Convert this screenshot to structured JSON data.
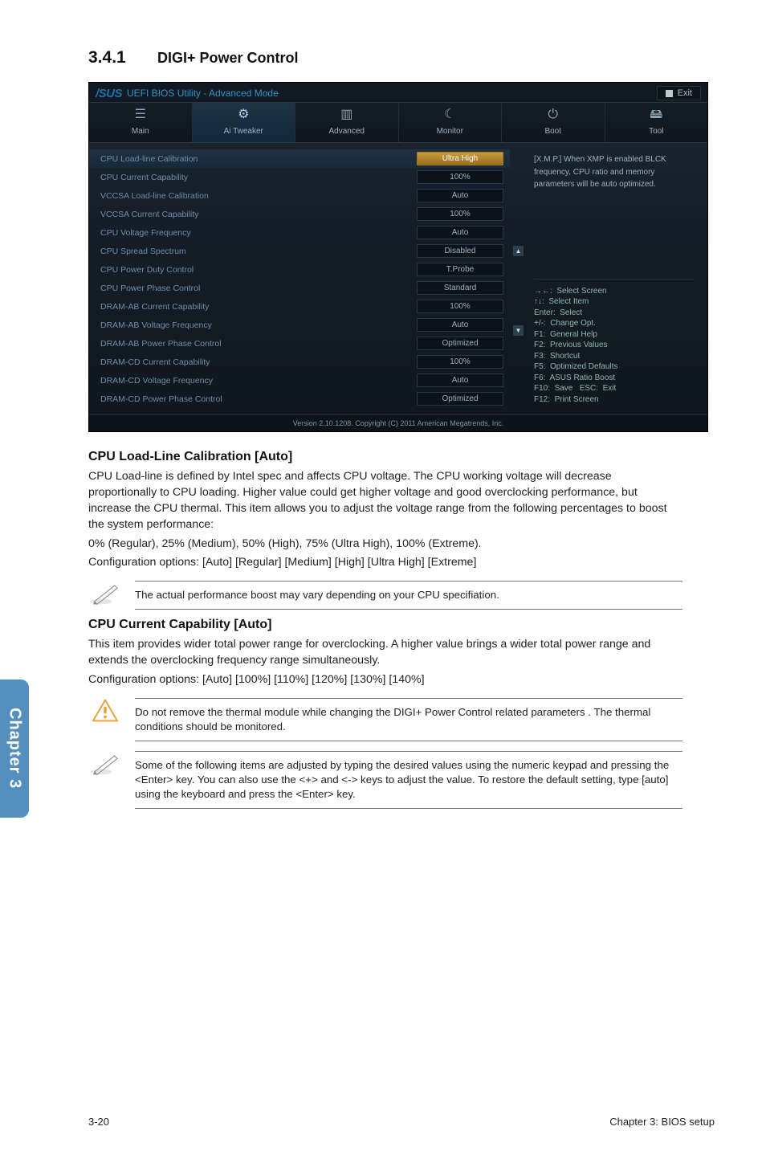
{
  "section_number": "3.4.1",
  "section_title": "DIGI+ Power Control",
  "bios": {
    "brand": "/SUS",
    "title": "UEFI BIOS Utility - Advanced Mode",
    "exit": "Exit",
    "tabs": [
      {
        "label": "Main",
        "icon": "☰"
      },
      {
        "label": "Ai Tweaker",
        "icon": "⚙"
      },
      {
        "label": "Advanced",
        "icon": "▥"
      },
      {
        "label": "Monitor",
        "icon": "☾"
      },
      {
        "label": "Boot",
        "icon": "⏻"
      },
      {
        "label": "Tool",
        "icon": "🖴"
      }
    ],
    "rows": [
      {
        "label": "CPU Load-line Calibration",
        "value": "Ultra High",
        "selected": true,
        "variant": "ultra"
      },
      {
        "label": "CPU Current Capability",
        "value": "100%"
      },
      {
        "label": "VCCSA Load-line Calibration",
        "value": "Auto"
      },
      {
        "label": "VCCSA Current Capability",
        "value": "100%"
      },
      {
        "label": "CPU Voltage Frequency",
        "value": "Auto"
      },
      {
        "label": "CPU Spread Spectrum",
        "value": "Disabled"
      },
      {
        "label": "CPU Power Duty Control",
        "value": "T.Probe"
      },
      {
        "label": "CPU Power Phase Control",
        "value": "Standard"
      },
      {
        "label": "DRAM-AB Current Capability",
        "value": "100%"
      },
      {
        "label": "DRAM-AB Voltage Frequency",
        "value": "Auto"
      },
      {
        "label": "DRAM-AB Power Phase Control",
        "value": "Optimized"
      },
      {
        "label": "DRAM-CD Current Capability",
        "value": "100%"
      },
      {
        "label": "DRAM-CD Voltage Frequency",
        "value": "Auto"
      },
      {
        "label": "DRAM-CD Power Phase Control",
        "value": "Optimized"
      }
    ],
    "info_lines": [
      "[X.M.P.] When XMP is enabled BLCK",
      "frequency, CPU ratio and memory",
      "parameters will be auto optimized."
    ],
    "help_lines": [
      "→←:  Select Screen",
      "↑↓:  Select Item",
      "Enter:  Select",
      "+/-:  Change Opt.",
      "F1:  General Help",
      "F2:  Previous Values",
      "F3:  Shortcut",
      "F5:  Optimized Defaults",
      "F6:  ASUS Ratio Boost",
      "F10:  Save   ESC:  Exit",
      "F12:  Print Screen"
    ],
    "footer": "Version  2.10.1208.   Copyright  (C)  2011  American  Megatrends,  Inc."
  },
  "subheads": {
    "cll": "CPU Load-Line Calibration [Auto]",
    "ccc": "CPU Current Capability [Auto]"
  },
  "paragraphs": {
    "cll1": "CPU Load-line is defined by Intel spec and affects CPU voltage. The CPU working voltage will decrease proportionally to CPU loading. Higher value could get higher voltage and good overclocking performance, but increase the CPU thermal. This item allows you to adjust the voltage range from the following percentages to boost the system performance:",
    "cll2": "0% (Regular), 25% (Medium), 50% (High), 75% (Ultra High), 100% (Extreme).",
    "cll3": "Configuration options: [Auto] [Regular] [Medium] [High] [Ultra High] [Extreme]",
    "ccc1": "This item provides wider total power range for overclocking. A higher value brings a wider total power range and extends the overclocking frequency range simultaneously.",
    "ccc2": "Configuration options: [Auto] [100%] [110%] [120%] [130%] [140%]"
  },
  "notes": {
    "perf": "The actual performance boost may vary depending on your CPU specifiation.",
    "warn": "Do not remove the thermal module while changing the DIGI+ Power Control related parameters . The thermal conditions should be monitored.",
    "adjust": "Some of the following items are adjusted by typing the desired values using the numeric keypad and pressing the <Enter> key. You can also use the <+> and <-> keys to adjust the value. To restore the default setting, type [auto] using the keyboard and press the <Enter> key."
  },
  "side_tab": "Chapter 3",
  "footer_left": "3-20",
  "footer_right": "Chapter 3: BIOS setup"
}
